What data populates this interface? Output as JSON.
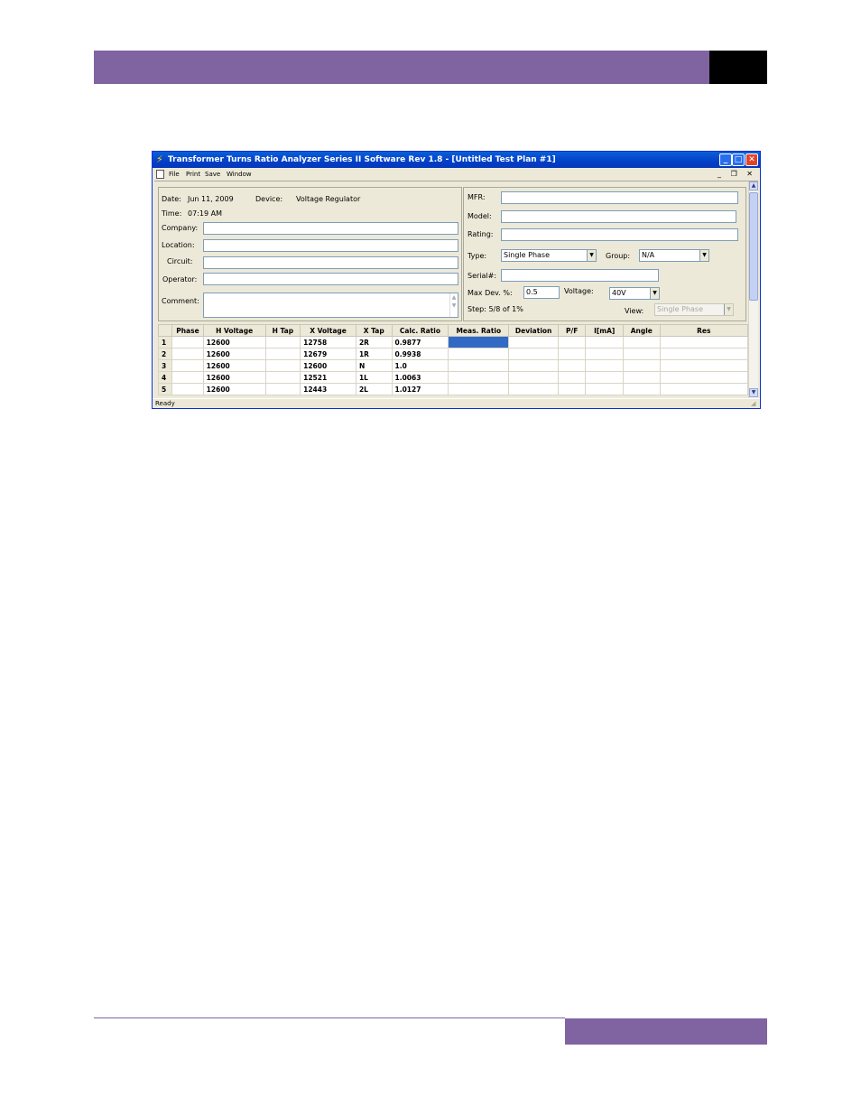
{
  "colors": {
    "accent": "#8064a2",
    "titlebar": "#0340c8",
    "selection": "#316ac5"
  },
  "window": {
    "title": "Transformer Turns Ratio Analyzer Series II Software Rev 1.8 - [Untitled Test Plan #1]",
    "icon": "lightning-icon",
    "controls": {
      "minimize": "_",
      "maximize": "□",
      "close": "✕"
    }
  },
  "menu": {
    "items": [
      "File",
      "Print",
      "Save",
      "Window"
    ],
    "mdi_controls": "_ ❐ ✕"
  },
  "left_panel": {
    "date_label": "Date:",
    "date_value": "Jun 11, 2009",
    "device_label": "Device:",
    "device_value": "Voltage Regulator",
    "time_label": "Time:",
    "time_value": "07:19 AM",
    "company_label": "Company:",
    "company_value": "",
    "location_label": "Location:",
    "location_value": "",
    "circuit_label": "Circuit:",
    "circuit_value": "",
    "operator_label": "Operator:",
    "operator_value": "",
    "comment_label": "Comment:",
    "comment_value": ""
  },
  "right_panel": {
    "mfr_label": "MFR:",
    "mfr_value": "",
    "model_label": "Model:",
    "model_value": "",
    "rating_label": "Rating:",
    "rating_value": "",
    "type_label": "Type:",
    "type_value": "Single Phase",
    "group_label": "Group:",
    "group_value": "N/A",
    "serial_label": "Serial#:",
    "serial_value": "",
    "maxdev_label": "Max Dev. %:",
    "maxdev_value": "0.5",
    "voltage_label": "Voltage:",
    "voltage_value": "40V",
    "step_label": "Step: 5/8 of 1%",
    "view_label": "View:",
    "view_value": "Single Phase"
  },
  "table": {
    "columns": [
      "",
      "Phase",
      "H Voltage",
      "H Tap",
      "X Voltage",
      "X Tap",
      "Calc. Ratio",
      "Meas. Ratio",
      "Deviation",
      "P/F",
      "I[mA]",
      "Angle",
      "Res"
    ],
    "rows": [
      [
        "1",
        "",
        "12600",
        "",
        "12758",
        "2R",
        "0.9877",
        "",
        "",
        "",
        "",
        "",
        ""
      ],
      [
        "2",
        "",
        "12600",
        "",
        "12679",
        "1R",
        "0.9938",
        "",
        "",
        "",
        "",
        "",
        ""
      ],
      [
        "3",
        "",
        "12600",
        "",
        "12600",
        "N",
        "1.0",
        "",
        "",
        "",
        "",
        "",
        ""
      ],
      [
        "4",
        "",
        "12600",
        "",
        "12521",
        "1L",
        "1.0063",
        "",
        "",
        "",
        "",
        "",
        ""
      ],
      [
        "5",
        "",
        "12600",
        "",
        "12443",
        "2L",
        "1.0127",
        "",
        "",
        "",
        "",
        "",
        ""
      ]
    ]
  },
  "status": {
    "text": "Ready"
  }
}
